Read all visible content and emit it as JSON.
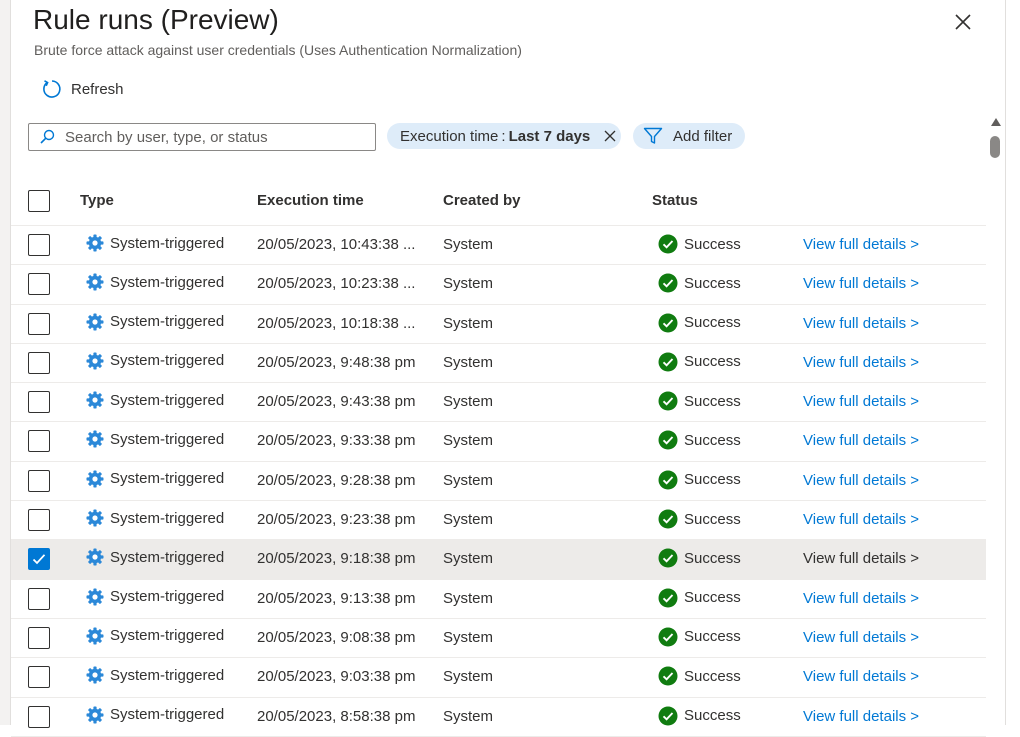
{
  "panel": {
    "title": "Rule runs (Preview)",
    "subtitle": "Brute force attack against user credentials (Uses Authentication Normalization)",
    "refresh_label": "Refresh",
    "close_icon": "close-icon"
  },
  "search": {
    "placeholder": "Search by user, type, or status",
    "value": ""
  },
  "filters": {
    "exec_label": "Execution time",
    "exec_sep": ":",
    "exec_value": "Last 7 days",
    "add_filter_label": "Add filter"
  },
  "table": {
    "columns": {
      "type": "Type",
      "execution_time": "Execution time",
      "created_by": "Created by",
      "status": "Status"
    },
    "rows": [
      {
        "type": "System-triggered",
        "execution_time": "20/05/2023, 10:43:38 ...",
        "created_by": "System",
        "status": "Success",
        "link": "View full details >",
        "selected": false
      },
      {
        "type": "System-triggered",
        "execution_time": "20/05/2023, 10:23:38 ...",
        "created_by": "System",
        "status": "Success",
        "link": "View full details >",
        "selected": false
      },
      {
        "type": "System-triggered",
        "execution_time": "20/05/2023, 10:18:38 ...",
        "created_by": "System",
        "status": "Success",
        "link": "View full details >",
        "selected": false
      },
      {
        "type": "System-triggered",
        "execution_time": "20/05/2023, 9:48:38 pm",
        "created_by": "System",
        "status": "Success",
        "link": "View full details >",
        "selected": false
      },
      {
        "type": "System-triggered",
        "execution_time": "20/05/2023, 9:43:38 pm",
        "created_by": "System",
        "status": "Success",
        "link": "View full details >",
        "selected": false
      },
      {
        "type": "System-triggered",
        "execution_time": "20/05/2023, 9:33:38 pm",
        "created_by": "System",
        "status": "Success",
        "link": "View full details >",
        "selected": false
      },
      {
        "type": "System-triggered",
        "execution_time": "20/05/2023, 9:28:38 pm",
        "created_by": "System",
        "status": "Success",
        "link": "View full details >",
        "selected": false
      },
      {
        "type": "System-triggered",
        "execution_time": "20/05/2023, 9:23:38 pm",
        "created_by": "System",
        "status": "Success",
        "link": "View full details >",
        "selected": false
      },
      {
        "type": "System-triggered",
        "execution_time": "20/05/2023, 9:18:38 pm",
        "created_by": "System",
        "status": "Success",
        "link": "View full details >",
        "selected": true
      },
      {
        "type": "System-triggered",
        "execution_time": "20/05/2023, 9:13:38 pm",
        "created_by": "System",
        "status": "Success",
        "link": "View full details >",
        "selected": false
      },
      {
        "type": "System-triggered",
        "execution_time": "20/05/2023, 9:08:38 pm",
        "created_by": "System",
        "status": "Success",
        "link": "View full details >",
        "selected": false
      },
      {
        "type": "System-triggered",
        "execution_time": "20/05/2023, 9:03:38 pm",
        "created_by": "System",
        "status": "Success",
        "link": "View full details >",
        "selected": false
      },
      {
        "type": "System-triggered",
        "execution_time": "20/05/2023, 8:58:38 pm",
        "created_by": "System",
        "status": "Success",
        "link": "View full details >",
        "selected": false
      }
    ]
  },
  "colors": {
    "accent": "#0078d4",
    "success": "#107c10",
    "gear": "#2b88d8",
    "pill_bg": "#deecf9",
    "selected_row": "#edebe9"
  },
  "icons": {
    "refresh": "refresh-icon",
    "search": "search-icon",
    "filter": "filter-icon",
    "type": "gear-icon",
    "status": "check-circle-icon",
    "row_selected": "checkmark-icon"
  }
}
